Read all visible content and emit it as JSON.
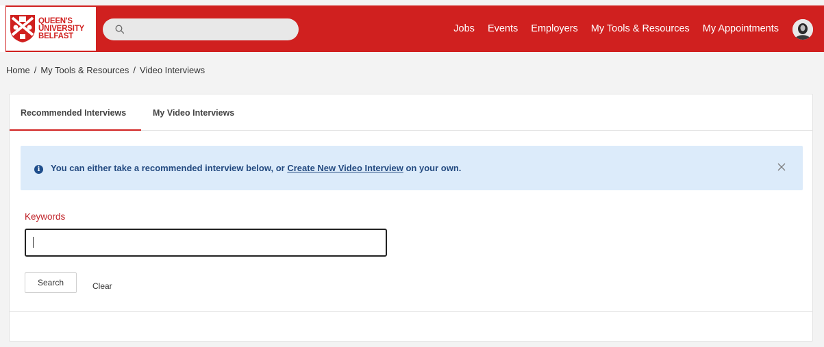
{
  "brand": {
    "logo_alt": "QUEEN'S UNIVERSITY BELFAST",
    "line1": "QUEEN'S",
    "line2": "UNIVERSITY",
    "line3": "BELFAST",
    "color": "#d0201f"
  },
  "search": {
    "placeholder": ""
  },
  "nav": {
    "items": [
      {
        "label": "Jobs"
      },
      {
        "label": "Events"
      },
      {
        "label": "Employers"
      },
      {
        "label": "My Tools & Resources"
      },
      {
        "label": "My Appointments"
      }
    ]
  },
  "breadcrumb": {
    "items": [
      "Home",
      "My Tools & Resources",
      "Video Interviews"
    ],
    "separator": "/"
  },
  "tabs": [
    {
      "label": "Recommended Interviews",
      "active": true
    },
    {
      "label": "My Video Interviews",
      "active": false
    }
  ],
  "alert": {
    "text_before": "You can either take a recommended interview below, or ",
    "link_text": "Create New Video Interview",
    "text_after": " on your own.",
    "icon": "info-icon",
    "close_icon": "close-icon",
    "background": "#dcebfa"
  },
  "filters": {
    "keywords_label": "Keywords",
    "keywords_value": "",
    "search_label": "Search",
    "clear_label": "Clear"
  }
}
